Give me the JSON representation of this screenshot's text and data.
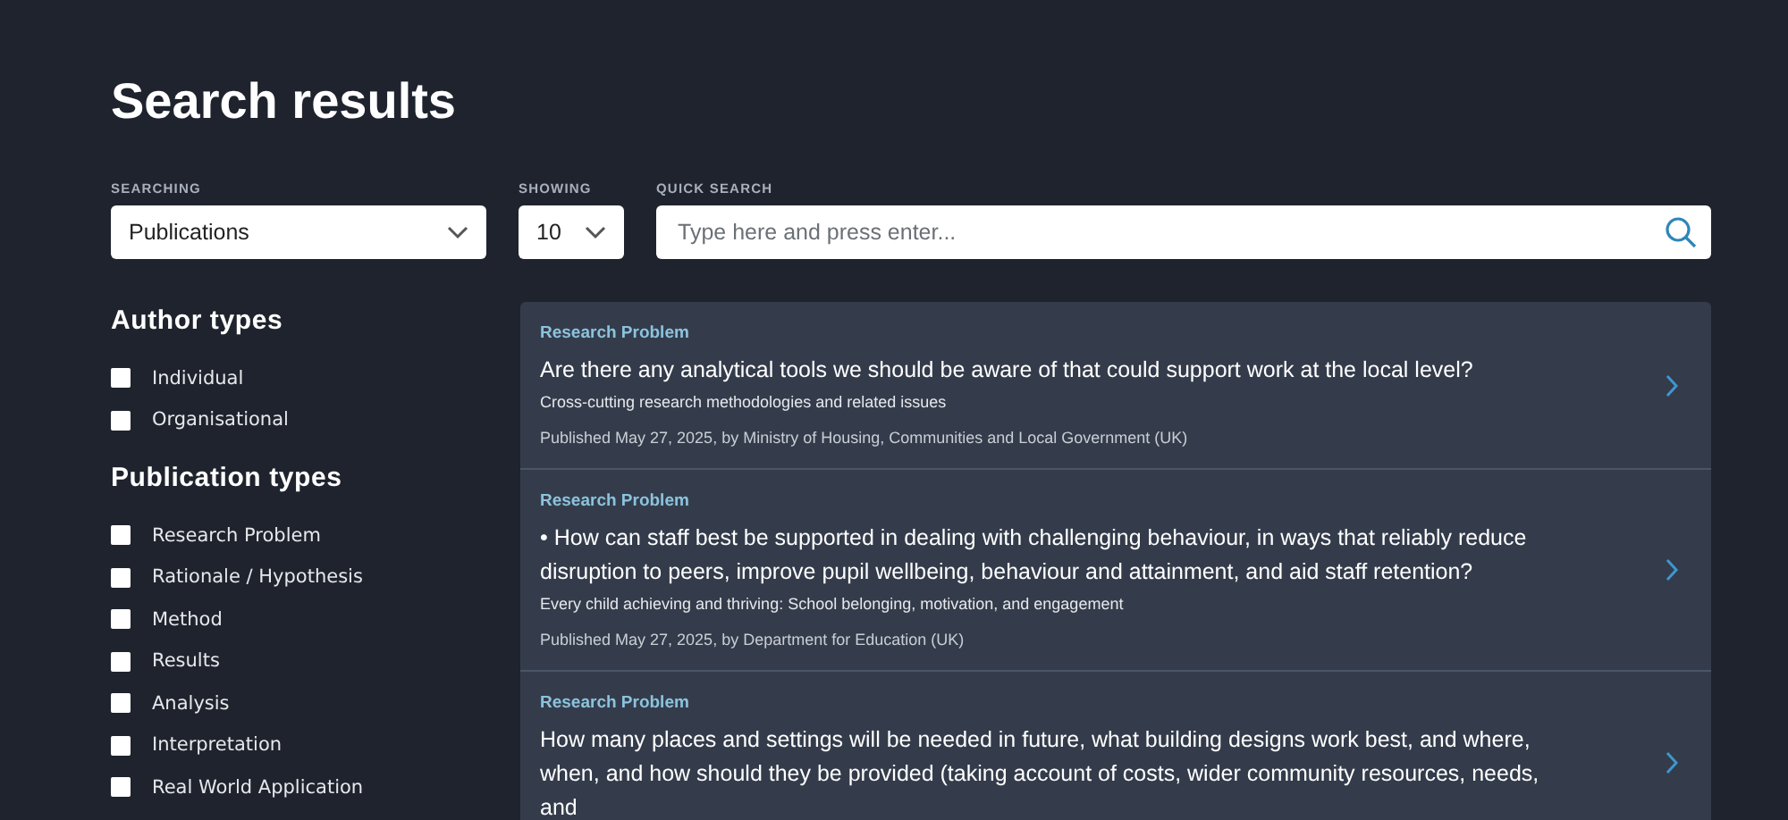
{
  "page_title": "Search results",
  "filters": {
    "searching": {
      "label": "SEARCHING",
      "value": "Publications"
    },
    "showing": {
      "label": "SHOWING",
      "value": "10"
    },
    "quick_search": {
      "label": "QUICK SEARCH",
      "placeholder": "Type here and press enter..."
    }
  },
  "sidebar": [
    {
      "heading": "Author types",
      "options": [
        {
          "label": "Individual",
          "checked": false
        },
        {
          "label": "Organisational",
          "checked": false
        }
      ]
    },
    {
      "heading": "Publication types",
      "options": [
        {
          "label": "Research Problem",
          "checked": false
        },
        {
          "label": "Rationale / Hypothesis",
          "checked": false
        },
        {
          "label": "Method",
          "checked": false
        },
        {
          "label": "Results",
          "checked": false
        },
        {
          "label": "Analysis",
          "checked": false
        },
        {
          "label": "Interpretation",
          "checked": false
        },
        {
          "label": "Real World Application",
          "checked": false
        }
      ]
    }
  ],
  "results": [
    {
      "type": "Research Problem",
      "title": "Are there any analytical tools we should be aware of that could support work at the local level?",
      "topic": "Cross-cutting research methodologies and related issues",
      "published": "Published May 27, 2025, by Ministry of Housing, Communities and Local Government (UK)"
    },
    {
      "type": "Research Problem",
      "title": "• How can staff best be supported in dealing with challenging behaviour, in ways that reliably reduce disruption to peers, improve pupil wellbeing, behaviour and attainment, and aid staff retention?",
      "topic": "Every child achieving and thriving: School belonging, motivation, and engagement",
      "published": "Published May 27, 2025, by Department for Education (UK)"
    },
    {
      "type": "Research Problem",
      "title": "How many places and settings will be needed in future, what building designs work best, and where, when, and how should they be provided (taking account of costs, wider community resources, needs, and"
    }
  ]
}
